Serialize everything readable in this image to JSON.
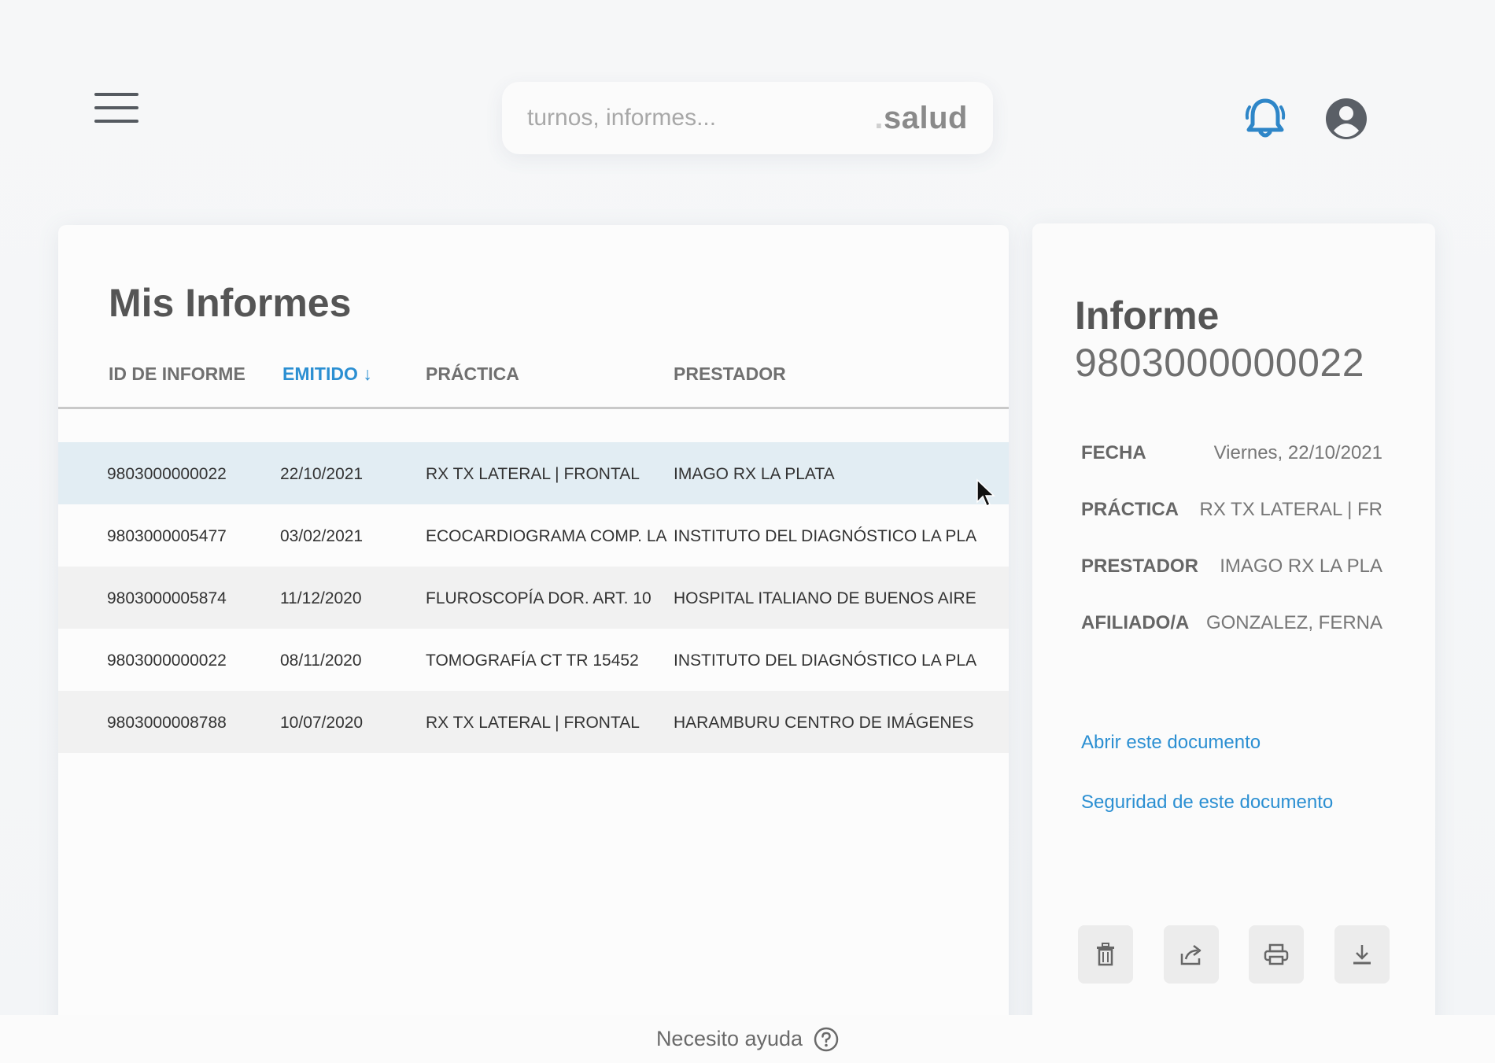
{
  "header": {
    "search_placeholder": "turnos, informes...",
    "brand_dot": ".",
    "brand_name": "salud"
  },
  "list": {
    "title": "Mis Informes",
    "columns": [
      "ID DE INFORME",
      "EMITIDO ↓",
      "PRÁCTICA",
      "PRESTADOR"
    ],
    "rows": [
      {
        "id": "9803000000022",
        "date": "22/10/2021",
        "practice": "RX TX LATERAL | FRONTAL",
        "provider": "IMAGO RX LA PLATA",
        "selected": true
      },
      {
        "id": "9803000005477",
        "date": "03/02/2021",
        "practice": "ECOCARDIOGRAMA COMP. LA",
        "provider": "INSTITUTO DEL DIAGNÓSTICO LA PLA"
      },
      {
        "id": "9803000005874",
        "date": "11/12/2020",
        "practice": "FLUROSCOPÍA DOR. ART. 10",
        "provider": "HOSPITAL ITALIANO DE BUENOS AIRE"
      },
      {
        "id": "9803000000022",
        "date": "08/11/2020",
        "practice": "TOMOGRAFÍA CT TR 15452",
        "provider": "INSTITUTO DEL DIAGNÓSTICO LA PLA"
      },
      {
        "id": "9803000008788",
        "date": "10/07/2020",
        "practice": "RX TX LATERAL | FRONTAL",
        "provider": "HARAMBURU CENTRO DE IMÁGENES"
      }
    ]
  },
  "detail": {
    "title": "Informe",
    "id": "9803000000022",
    "fields": [
      {
        "label": "FECHA",
        "value": "Viernes, 22/10/2021"
      },
      {
        "label": "PRÁCTICA",
        "value": "RX TX LATERAL | FR"
      },
      {
        "label": "PRESTADOR",
        "value": "IMAGO RX LA PLA"
      },
      {
        "label": "AFILIADO/A",
        "value": "GONZALEZ, FERNA"
      }
    ],
    "open_link": "Abrir este documento",
    "security_link": "Seguridad de este documento",
    "actions": [
      "trash-icon",
      "share-icon",
      "print-icon",
      "download-icon"
    ]
  },
  "footer": {
    "help_text": "Necesito ayuda"
  },
  "colors": {
    "accent": "#2b8fd2",
    "selected_row": "#e2edf3",
    "alt_row": "#f1f1f1"
  }
}
